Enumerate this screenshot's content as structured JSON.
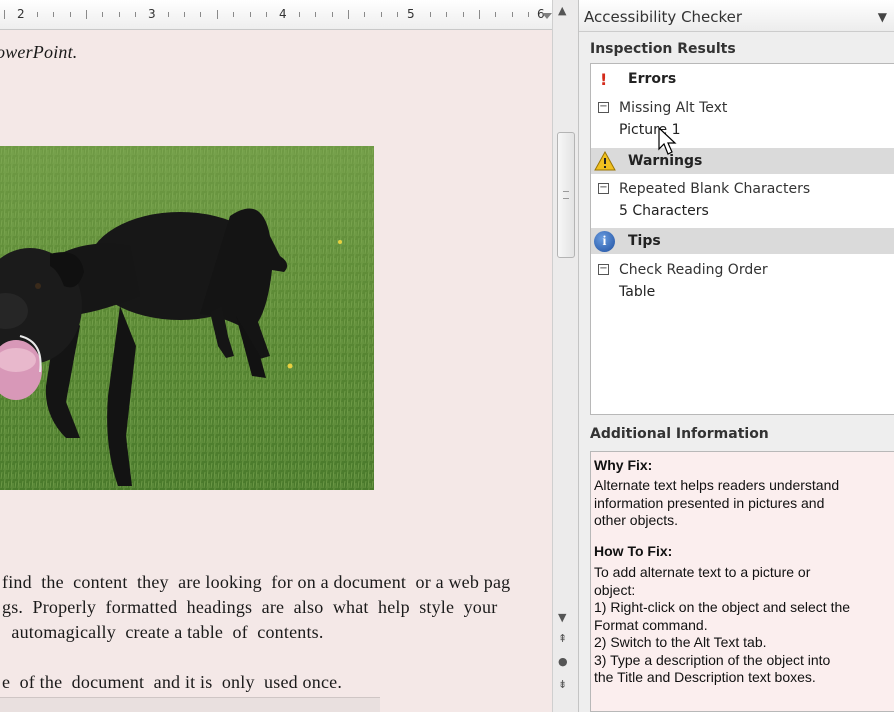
{
  "ruler": {
    "numbers": [
      "2",
      "3",
      "4",
      "5",
      "6"
    ]
  },
  "document": {
    "heading": "owerPoint.",
    "paragraph_lines": [
      "find  the  content  they  are looking  for on a document  or a web pag",
      "gs.  Properly  formatted  headings  are  also  what  help  style  your",
      "  automagically  create a table  of  contents.",
      "e  of the  document  and it is  only  used once."
    ],
    "image_alt": "black dog on grass"
  },
  "pane": {
    "title": "Accessibility Checker",
    "menu_icon": "dropdown-arrow-icon",
    "inspection_title": "Inspection Results",
    "groups": [
      {
        "label": "Errors",
        "icon": "error-icon",
        "issue": "Missing Alt Text",
        "detail": "Picture 1"
      },
      {
        "label": "Warnings",
        "icon": "warning-icon",
        "issue": "Repeated Blank Characters",
        "detail": "5 Characters"
      },
      {
        "label": "Tips",
        "icon": "info-icon",
        "issue": "Check Reading Order",
        "detail": "Table"
      }
    ],
    "additional_title": "Additional Information",
    "why_fix_heading": "Why Fix:",
    "why_fix_lines": [
      "Alternate text helps readers understand",
      "information presented in pictures and",
      "other objects."
    ],
    "how_to_fix_heading": "How To Fix:",
    "how_to_fix_lines": [
      "To add alternate text to a picture or",
      "object:",
      "1) Right-click on the object and select the",
      "Format command.",
      "2) Switch to the Alt Text tab.",
      "3) Type a description of the object into",
      "the Title and Description text boxes."
    ]
  },
  "colors": {
    "document_bg": "#f4e8e7",
    "error": "#d42a1a",
    "warning": "#f0c020",
    "info": "#1e4fa0",
    "group_shade": "#dadada"
  }
}
